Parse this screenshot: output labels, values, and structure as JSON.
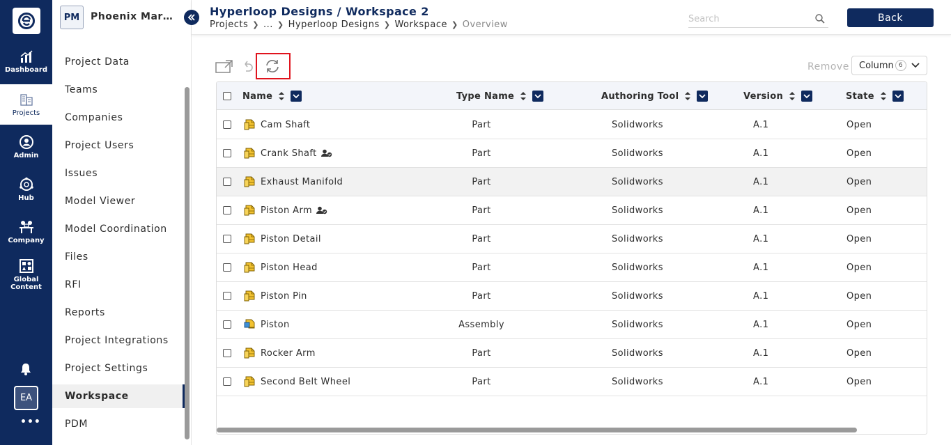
{
  "rail": {
    "items": [
      {
        "label": "Dashboard",
        "icon": "bar-chart-icon"
      },
      {
        "label": "Projects",
        "icon": "buildings-icon"
      },
      {
        "label": "Admin",
        "icon": "admin-icon"
      },
      {
        "label": "Hub",
        "icon": "hub-icon"
      },
      {
        "label": "Company",
        "icon": "company-icon"
      },
      {
        "label": "Global Content",
        "icon": "global-content-icon"
      }
    ],
    "avatar": "EA",
    "more": "•••"
  },
  "sidebar": {
    "badge": "PM",
    "title": "Phoenix Marketing",
    "items": [
      {
        "label": "Project Data"
      },
      {
        "label": "Teams"
      },
      {
        "label": "Companies"
      },
      {
        "label": "Project Users"
      },
      {
        "label": "Issues"
      },
      {
        "label": "Model Viewer"
      },
      {
        "label": "Model Coordination"
      },
      {
        "label": "Files"
      },
      {
        "label": "RFI"
      },
      {
        "label": "Reports"
      },
      {
        "label": "Project Integrations"
      },
      {
        "label": "Project Settings"
      },
      {
        "label": "Workspace"
      },
      {
        "label": "PDM"
      }
    ],
    "active": "Workspace"
  },
  "header": {
    "title": "Hyperloop Designs / Workspace 2",
    "breadcrumbs": [
      "Projects",
      "...",
      "Hyperloop Designs",
      "Workspace",
      "Overview"
    ],
    "search_placeholder": "Search",
    "back_label": "Back"
  },
  "toolbar": {
    "remove_label": "Remove",
    "column_label": "Column",
    "column_count": "6"
  },
  "table": {
    "columns": [
      "Name",
      "Type Name",
      "Authoring Tool",
      "Version",
      "State"
    ],
    "rows": [
      {
        "name": "Cam Shaft",
        "type": "Part",
        "tool": "Solidworks",
        "version": "A.1",
        "state": "Open",
        "icon": "part-icon",
        "user": false
      },
      {
        "name": "Crank Shaft",
        "type": "Part",
        "tool": "Solidworks",
        "version": "A.1",
        "state": "Open",
        "icon": "part-icon",
        "user": true
      },
      {
        "name": "Exhaust Manifold",
        "type": "Part",
        "tool": "Solidworks",
        "version": "A.1",
        "state": "Open",
        "icon": "part-icon",
        "user": false
      },
      {
        "name": "Piston Arm",
        "type": "Part",
        "tool": "Solidworks",
        "version": "A.1",
        "state": "Open",
        "icon": "part-icon",
        "user": true
      },
      {
        "name": "Piston Detail",
        "type": "Part",
        "tool": "Solidworks",
        "version": "A.1",
        "state": "Open",
        "icon": "part-icon",
        "user": false
      },
      {
        "name": "Piston Head",
        "type": "Part",
        "tool": "Solidworks",
        "version": "A.1",
        "state": "Open",
        "icon": "part-icon",
        "user": false
      },
      {
        "name": "Piston Pin",
        "type": "Part",
        "tool": "Solidworks",
        "version": "A.1",
        "state": "Open",
        "icon": "part-icon",
        "user": false
      },
      {
        "name": "Piston",
        "type": "Assembly",
        "tool": "Solidworks",
        "version": "A.1",
        "state": "Open",
        "icon": "assembly-icon",
        "user": false
      },
      {
        "name": "Rocker Arm",
        "type": "Part",
        "tool": "Solidworks",
        "version": "A.1",
        "state": "Open",
        "icon": "part-icon",
        "user": false
      },
      {
        "name": "Second Belt Wheel",
        "type": "Part",
        "tool": "Solidworks",
        "version": "A.1",
        "state": "Open",
        "icon": "part-icon",
        "user": false
      }
    ]
  },
  "colors": {
    "navy": "#0f2a5e",
    "highlight_box": "#e0141e",
    "part_yellow": "#f2c230",
    "assembly_blue": "#3d8fd6"
  }
}
